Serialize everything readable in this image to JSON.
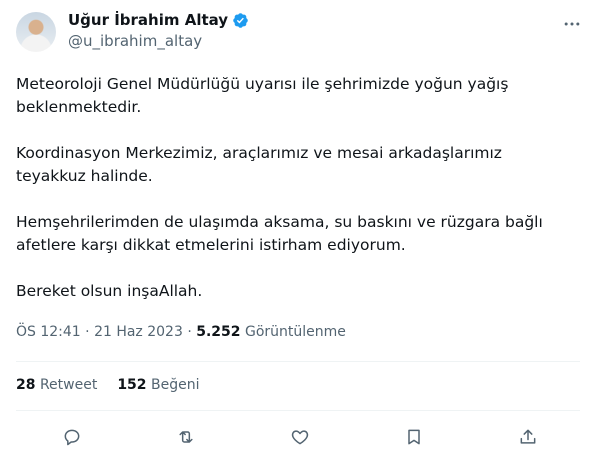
{
  "author": {
    "name": "Uğur İbrahim Altay",
    "handle": "@u_ibrahim_altay",
    "verified": true,
    "verified_color": "#1d9bf0"
  },
  "tweet": {
    "paragraphs": [
      "Meteoroloji Genel Müdürlüğü uyarısı ile şehrimizde yoğun yağış beklenmektedir.",
      "Koordinasyon Merkezimiz, araçlarımız ve mesai arkadaşlarımız teyakkuz halinde.",
      "Hemşehrilerimden de ulaşımda aksama, su baskını ve rüzgara bağlı afetlere karşı dikkat etmelerini istirham ediyorum.",
      "Bereket olsun inşaAllah."
    ]
  },
  "meta": {
    "time": "ÖS 12:41",
    "sep1": " · ",
    "date": "21 Haz 2023",
    "sep2": " · ",
    "views_count": "5.252",
    "views_label": " Görüntülenme"
  },
  "stats": {
    "retweets_count": "28",
    "retweets_label": "Retweet",
    "likes_count": "152",
    "likes_label": "Beğeni"
  },
  "icons": {
    "more": "more-icon",
    "reply": "reply-icon",
    "retweet": "retweet-icon",
    "like": "like-icon",
    "bookmark": "bookmark-icon",
    "share": "share-icon"
  },
  "colors": {
    "text": "#0f1419",
    "secondary": "#536471",
    "divider": "#eff3f4",
    "accent": "#1d9bf0"
  }
}
